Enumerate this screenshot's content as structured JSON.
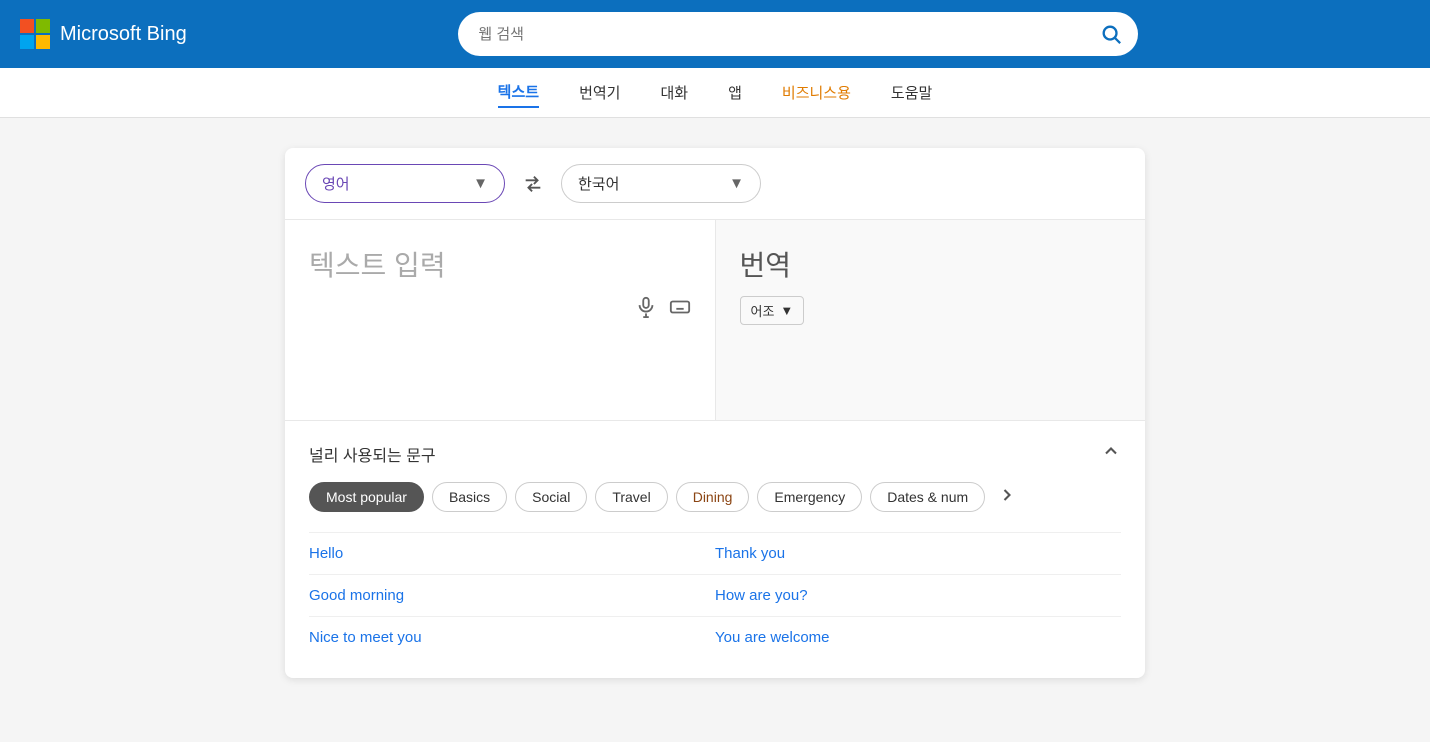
{
  "header": {
    "brand": "Microsoft Bing",
    "search_placeholder": "웹 검색"
  },
  "nav": {
    "items": [
      {
        "id": "text",
        "label": "텍스트",
        "active": true
      },
      {
        "id": "translator",
        "label": "번역기",
        "active": false
      },
      {
        "id": "chat",
        "label": "대화",
        "active": false
      },
      {
        "id": "app",
        "label": "앱",
        "active": false
      },
      {
        "id": "business",
        "label": "비즈니스용",
        "active": false,
        "special": true
      },
      {
        "id": "help",
        "label": "도움말",
        "active": false
      }
    ]
  },
  "translator": {
    "source_lang": "영어",
    "target_lang": "한국어",
    "swap_icon": "⇄",
    "input_placeholder": "텍스트 입력",
    "output_placeholder": "번역",
    "tone_label": "어조",
    "mic_icon": "🎤",
    "keyboard_icon": "⌨",
    "chevron_down": "▼",
    "tone_chevron": "▼"
  },
  "phrases": {
    "title": "널리 사용되는 문구",
    "collapse_icon": "∧",
    "categories": [
      {
        "id": "most-popular",
        "label": "Most popular",
        "active": true
      },
      {
        "id": "basics",
        "label": "Basics",
        "active": false
      },
      {
        "id": "social",
        "label": "Social",
        "active": false
      },
      {
        "id": "travel",
        "label": "Travel",
        "active": false
      },
      {
        "id": "dining",
        "label": "Dining",
        "active": false,
        "special": true
      },
      {
        "id": "emergency",
        "label": "Emergency",
        "active": false
      },
      {
        "id": "dates-num",
        "label": "Dates & num",
        "active": false
      }
    ],
    "next_icon": "›",
    "items": [
      {
        "left": "Hello",
        "right": "Thank you"
      },
      {
        "left": "Good morning",
        "right": "How are you?"
      },
      {
        "left": "Nice to meet you",
        "right": "You are welcome"
      }
    ]
  }
}
